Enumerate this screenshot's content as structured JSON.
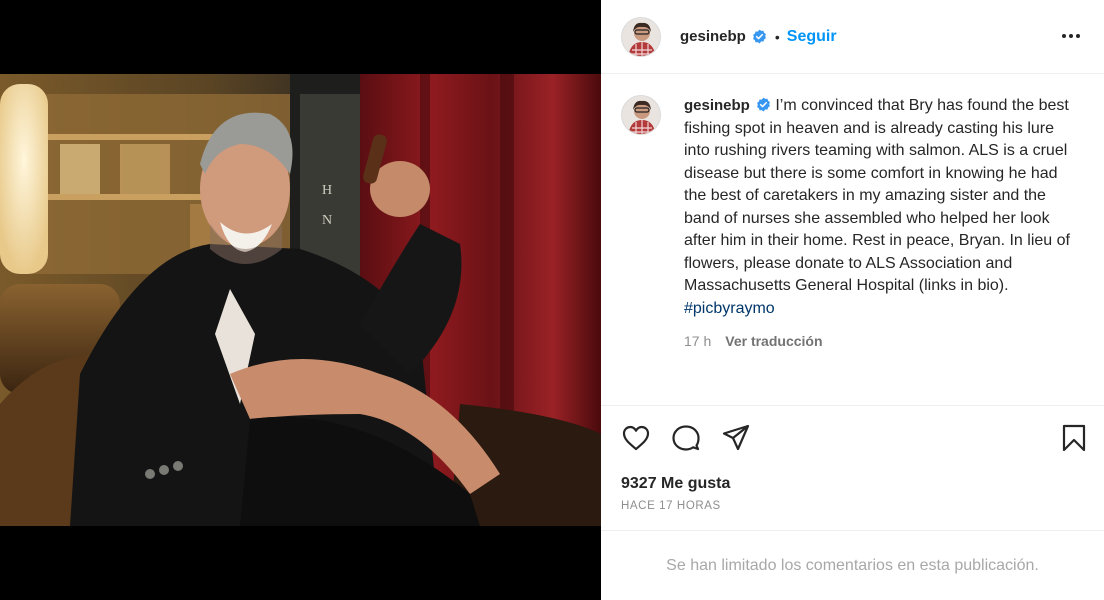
{
  "post": {
    "username": "gesinebp",
    "verified": true,
    "separator": "•",
    "follow_label": "Seguir",
    "more_icon": "more-options-icon",
    "caption": "I’m convinced that Bry has found the best fishing spot in heaven and is already casting his lure into rushing rivers teaming with salmon. ALS is a cruel disease but there is some comfort in knowing he had the best of caretakers in my amazing sister and the band of nurses she assembled who helped her look after him in their home. Rest in peace, Bryan. In lieu of flowers, please donate to ALS Association and Massachusetts General Hospital (links in bio).",
    "hashtag": "#picbyraymo",
    "time_short": "17 h",
    "translate_label": "Ver traducción",
    "likes_label": "9327 Me gusta",
    "time_ago": "HACE 17 HORAS",
    "comments_limited": "Se han limitado los comentarios en esta publicación."
  },
  "icons": {
    "like": "heart-icon",
    "comment": "comment-icon",
    "share": "share-icon",
    "save": "bookmark-icon"
  },
  "colors": {
    "accent": "#0095f6",
    "verified_badge": "#3897f0",
    "hashtag": "#00376b",
    "muted": "#8e8e8e"
  }
}
